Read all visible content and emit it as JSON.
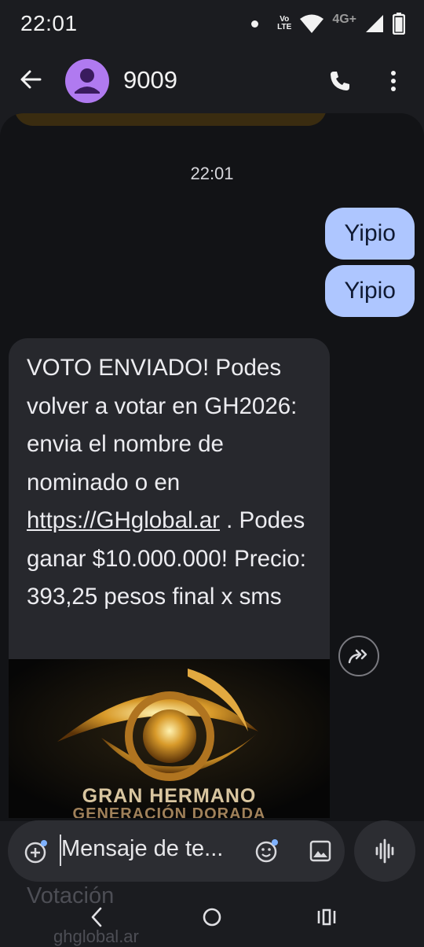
{
  "status_bar": {
    "time": "22:01",
    "volte_top": "Vo",
    "volte_bottom": "LTE",
    "network": "4G+"
  },
  "header": {
    "contact_name": "9009",
    "icons": [
      "back-arrow-icon",
      "avatar-person-icon",
      "phone-icon",
      "more-vert-icon"
    ]
  },
  "conversation": {
    "timestamp": "22:01",
    "sent_messages": [
      "Yipio",
      "Yipio"
    ],
    "received_message": {
      "text_before_link": "VOTO ENVIADO! Podes volver a votar en GH2026: envia el nombre de nominado o en ",
      "link": "https://GHglobal.ar",
      "text_after_link": " . Podes ganar $10.000.000! Precio: 393,25 pesos final x sms",
      "image": {
        "title": "GRAN HERMANO",
        "subtitle": "GENERACIÓN DORADA"
      }
    }
  },
  "composer": {
    "placeholder": "Mensaje de te..."
  },
  "behind": {
    "title": "Votación",
    "url": "ghglobal.ar"
  },
  "colors": {
    "sent_bubble": "#aec6ff",
    "received_bubble": "#27282d",
    "avatar": "#b07af0",
    "background": "#121316"
  }
}
